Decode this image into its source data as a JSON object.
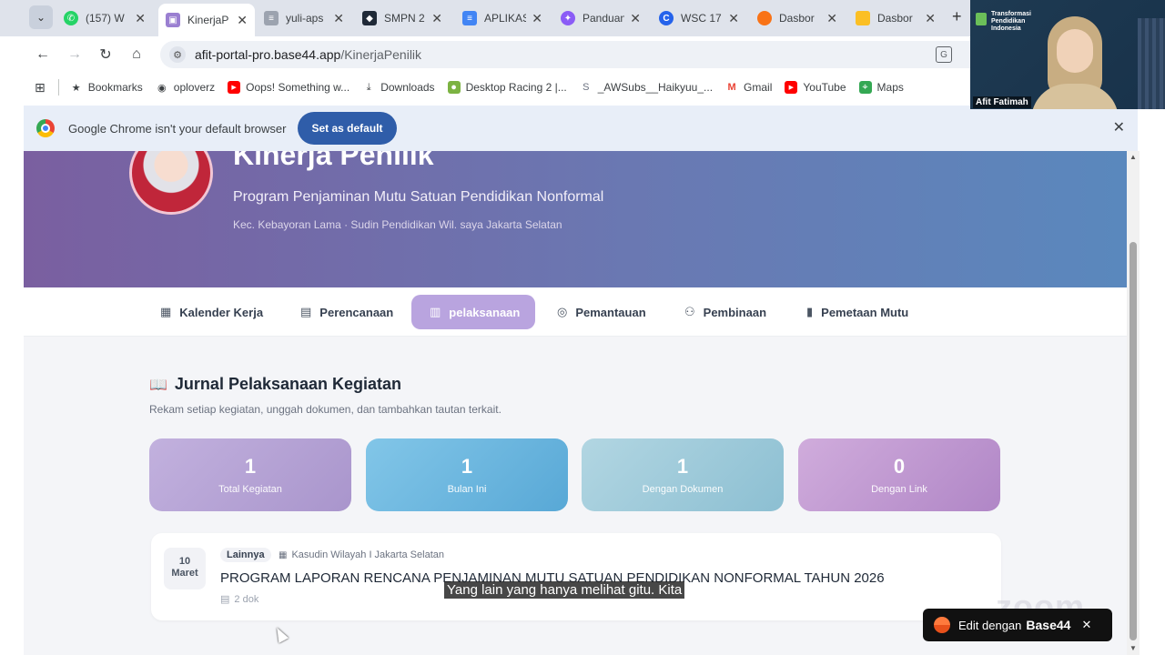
{
  "tabs": [
    {
      "title": "(157) W",
      "icon": "whatsapp-icon",
      "color": "#25d366",
      "active": false
    },
    {
      "title": "KinerjaP",
      "icon": "base44-icon",
      "color": "#9a7fd1",
      "active": true
    },
    {
      "title": "yuli-aps",
      "icon": "doc-icon",
      "color": "#6b7280",
      "active": false
    },
    {
      "title": "SMPN 2",
      "icon": "shield-icon",
      "color": "#1f2937",
      "active": false
    },
    {
      "title": "APLIKAS",
      "icon": "docs-icon",
      "color": "#4285f4",
      "active": false
    },
    {
      "title": "Panduan",
      "icon": "gem-icon",
      "color": "#8b5cf6",
      "active": false
    },
    {
      "title": "WSC 17",
      "icon": "c-icon",
      "color": "#2563eb",
      "active": false
    },
    {
      "title": "Dasbor",
      "icon": "circle-icon",
      "color": "#f97316",
      "active": false
    },
    {
      "title": "Dasbor",
      "icon": "folder-icon",
      "color": "#fbbf24",
      "active": false
    }
  ],
  "omnibox": {
    "domain": "afit-portal-pro.base44.app",
    "path": "/KinerjaPenilik"
  },
  "bookmarks": [
    {
      "label": "Bookmarks",
      "icon": "star-icon"
    },
    {
      "label": "oploverz",
      "icon": "globe-icon"
    },
    {
      "label": "Oops! Something w...",
      "icon": "youtube-icon"
    },
    {
      "label": "Downloads",
      "icon": "download-icon"
    },
    {
      "label": "Desktop Racing 2 |...",
      "icon": "racing-icon"
    },
    {
      "label": "_AWSubs__Haikyuu_...",
      "icon": "s-icon"
    },
    {
      "label": "Gmail",
      "icon": "gmail-icon"
    },
    {
      "label": "YouTube",
      "icon": "youtube-icon"
    },
    {
      "label": "Maps",
      "icon": "maps-icon"
    }
  ],
  "infobar": {
    "message": "Google Chrome isn't your default browser",
    "button": "Set as default"
  },
  "hero": {
    "title": "Kinerja Penilik",
    "subtitle": "Program Penjaminan Mutu Satuan Pendidikan Nonformal",
    "location": "Kec. Kebayoran Lama · Sudin Pendidikan Wil. saya Jakarta Selatan"
  },
  "nav": [
    {
      "label": "Kalender Kerja",
      "icon": "calendar-icon",
      "active": false
    },
    {
      "label": "Perencanaan",
      "icon": "document-icon",
      "active": false
    },
    {
      "label": "pelaksanaan",
      "icon": "clipboard-icon",
      "active": true
    },
    {
      "label": "Pemantauan",
      "icon": "eye-icon",
      "active": false
    },
    {
      "label": "Pembinaan",
      "icon": "users-icon",
      "active": false
    },
    {
      "label": "Pemetaan Mutu",
      "icon": "bar-chart-icon",
      "active": false
    }
  ],
  "section": {
    "title": "Jurnal Pelaksanaan Kegiatan",
    "description": "Rekam setiap kegiatan, unggah dokumen, dan tambahkan tautan terkait."
  },
  "stats": [
    {
      "value": "1",
      "label": "Total Kegiatan",
      "color": "#b8a5d6"
    },
    {
      "value": "1",
      "label": "Bulan Ini",
      "color": "#6db7de"
    },
    {
      "value": "1",
      "label": "Dengan Dokumen",
      "color": "#9ec9da"
    },
    {
      "value": "0",
      "label": "Dengan Link",
      "color": "#c39ad2"
    }
  ],
  "entry": {
    "day": "10",
    "month": "Maret",
    "tag": "Lainnya",
    "org": "Kasudin Wilayah I Jakarta Selatan",
    "title": "PROGRAM LAPORAN RENCANA PENJAMINAN MUTU SATUAN PENDIDIKAN NONFORMAL TAHUN 2026",
    "docs": "2 dok"
  },
  "caption": "Yang lain yang hanya melihat gitu. Kita",
  "watermark": "zoom",
  "edit_badge": {
    "text": "Edit dengan",
    "brand": "Base44"
  },
  "webcam": {
    "logo_text": "Transformasi Pendidikan Indonesia",
    "participant": "Afit Fatimah"
  }
}
